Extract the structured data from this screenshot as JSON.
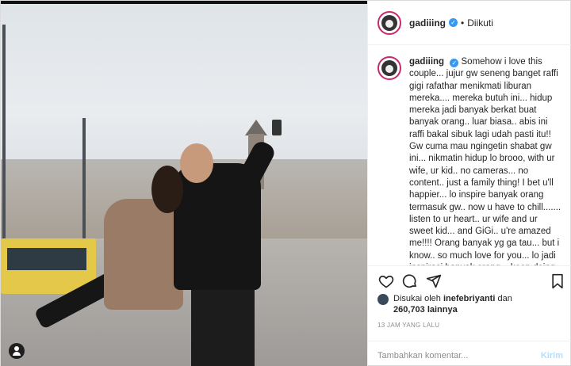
{
  "post": {
    "username": "gadiiing",
    "follow_separator": "•",
    "follow_status": "Diikuti",
    "caption": "Somehow i love this couple... jujur gw seneng banget raffi gigi rafathar menikmati liburan mereka.... mereka butuh ini... hidup mereka jadi banyak berkat buat banyak orang.. luar biasa.. abis ini raffi bakal sibuk lagi udah pasti itu!! Gw cuma mau ngingetin shabat gw ini... nikmatin hidup lo brooo, with ur wife, ur kid.. no cameras... no content.. just a family thing! I bet u'll happier... lo inspire banyak orang termasuk gw.. now u have to chill....... listen to ur heart.. ur wife and ur sweet kid... and GiGi.. u're amazed me!!!! Orang banyak yg ga tau... but i know.. so much love for you... lo jadi inspirasi banyak orang... keep doing that!!!!! And for rans team... u guys are fu****",
    "liked_by_prefix": "Disukai oleh",
    "liked_by_user": "inefebriyanti",
    "liked_by_joiner": "dan",
    "likes_count": "260,703",
    "likes_suffix": "lainnya",
    "timestamp": "13 JAM YANG LALU"
  },
  "icons": {
    "like": "heart-icon",
    "comment": "comment-icon",
    "share": "share-icon",
    "save": "bookmark-icon",
    "verified": "verified-badge-icon",
    "user_tag": "user-tag-icon"
  },
  "comment": {
    "placeholder": "Tambahkan komentar...",
    "post_label": "Kirim"
  },
  "colors": {
    "verified": "#3897f0",
    "post_button": "#b2dffc",
    "story_ring": "#c62a6d"
  }
}
